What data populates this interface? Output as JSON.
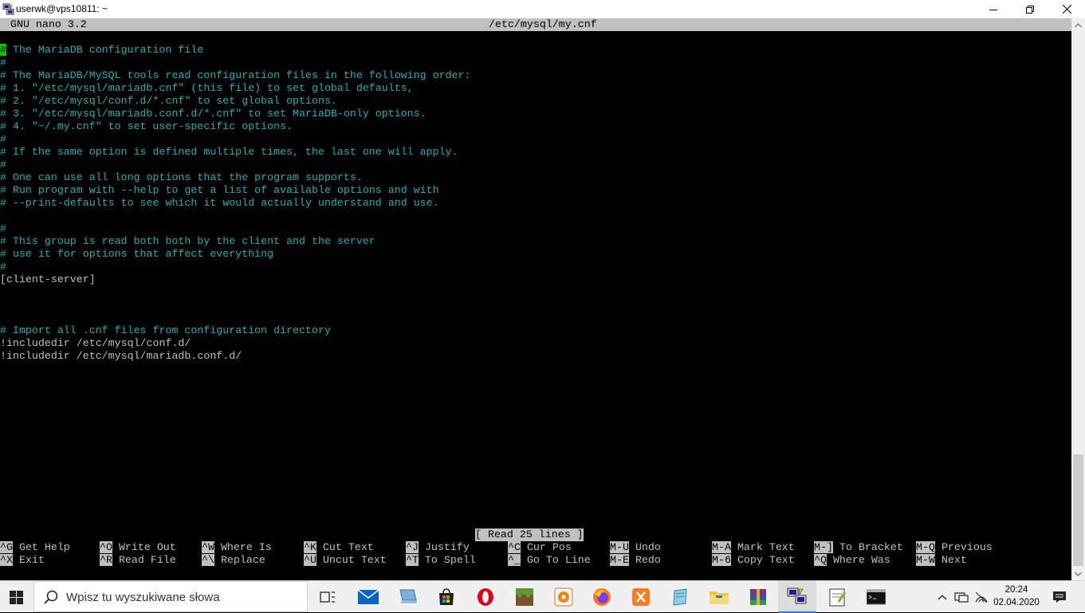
{
  "window": {
    "title": "userwk@vps10811: ~",
    "icon": "putty-icon"
  },
  "nano": {
    "version": "GNU nano 3.2",
    "filename": "/etc/mysql/my.cnf",
    "status": "[ Read 25 lines ]",
    "lines": [
      {
        "text": "# The MariaDB configuration file",
        "type": "comment",
        "cursor": true
      },
      {
        "text": "#",
        "type": "comment"
      },
      {
        "text": "# The MariaDB/MySQL tools read configuration files in the following order:",
        "type": "comment"
      },
      {
        "text": "# 1. \"/etc/mysql/mariadb.cnf\" (this file) to set global defaults,",
        "type": "comment"
      },
      {
        "text": "# 2. \"/etc/mysql/conf.d/*.cnf\" to set global options.",
        "type": "comment"
      },
      {
        "text": "# 3. \"/etc/mysql/mariadb.conf.d/*.cnf\" to set MariaDB-only options.",
        "type": "comment"
      },
      {
        "text": "# 4. \"~/.my.cnf\" to set user-specific options.",
        "type": "comment"
      },
      {
        "text": "#",
        "type": "comment"
      },
      {
        "text": "# If the same option is defined multiple times, the last one will apply.",
        "type": "comment"
      },
      {
        "text": "#",
        "type": "comment"
      },
      {
        "text": "# One can use all long options that the program supports.",
        "type": "comment"
      },
      {
        "text": "# Run program with --help to get a list of available options and with",
        "type": "comment"
      },
      {
        "text": "# --print-defaults to see which it would actually understand and use.",
        "type": "comment"
      },
      {
        "text": "",
        "type": "code"
      },
      {
        "text": "#",
        "type": "comment"
      },
      {
        "text": "# This group is read both both by the client and the server",
        "type": "comment"
      },
      {
        "text": "# use it for options that affect everything",
        "type": "comment"
      },
      {
        "text": "#",
        "type": "comment"
      },
      {
        "text": "[client-server]",
        "type": "code"
      },
      {
        "text": "",
        "type": "code"
      },
      {
        "text": "",
        "type": "code"
      },
      {
        "text": "",
        "type": "code"
      },
      {
        "text": "# Import all .cnf files from configuration directory",
        "type": "comment"
      },
      {
        "text": "!includedir /etc/mysql/conf.d/",
        "type": "code"
      },
      {
        "text": "!includedir /etc/mysql/mariadb.conf.d/",
        "type": "code"
      }
    ],
    "shortcuts_row1": [
      {
        "key": "^G",
        "label": "Get Help"
      },
      {
        "key": "^O",
        "label": "Write Out"
      },
      {
        "key": "^W",
        "label": "Where Is"
      },
      {
        "key": "^K",
        "label": "Cut Text"
      },
      {
        "key": "^J",
        "label": "Justify"
      },
      {
        "key": "^C",
        "label": "Cur Pos"
      },
      {
        "key": "M-U",
        "label": "Undo"
      },
      {
        "key": "M-A",
        "label": "Mark Text"
      },
      {
        "key": "M-]",
        "label": "To Bracket"
      },
      {
        "key": "M-Q",
        "label": "Previous"
      }
    ],
    "shortcuts_row2": [
      {
        "key": "^X",
        "label": "Exit"
      },
      {
        "key": "^R",
        "label": "Read File"
      },
      {
        "key": "^\\",
        "label": "Replace"
      },
      {
        "key": "^U",
        "label": "Uncut Text"
      },
      {
        "key": "^T",
        "label": "To Spell"
      },
      {
        "key": "^_",
        "label": "Go To Line"
      },
      {
        "key": "M-E",
        "label": "Redo"
      },
      {
        "key": "M-6",
        "label": "Copy Text"
      },
      {
        "key": "^Q",
        "label": "Where Was"
      },
      {
        "key": "M-W",
        "label": "Next"
      }
    ]
  },
  "taskbar": {
    "search_placeholder": "Wpisz tu wyszukiwane słowa",
    "apps": [
      "task-view-icon",
      "mail-icon",
      "computer-icon",
      "store-icon",
      "opera-icon",
      "minecraft-icon",
      "media-player-icon",
      "firefox-icon",
      "xampp-icon",
      "notepad-icon",
      "file-explorer-icon",
      "winrar-icon",
      "putty-icon",
      "notepadpp-icon",
      "cmd-icon"
    ],
    "time": "20:24",
    "date": "02.04.2020"
  },
  "colors": {
    "comment": "#19b2b2",
    "text": "#c0c0c0",
    "cursor": "#00cc00",
    "bar": "#c0c0c0"
  }
}
